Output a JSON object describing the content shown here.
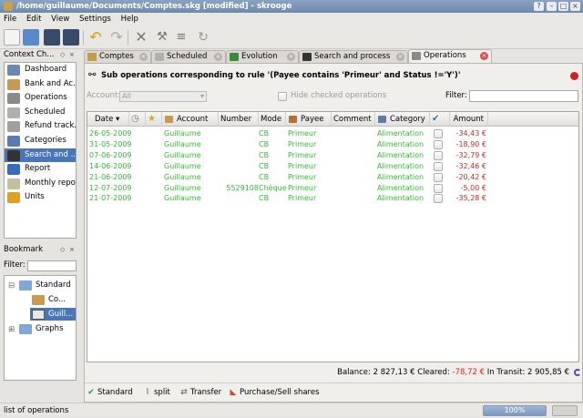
{
  "window": {
    "title": "/home/guillaume/Documents/Comptes.skg [modified] - skrooge"
  },
  "menu": [
    "File",
    "Edit",
    "View",
    "Settings",
    "Help"
  ],
  "context_dock": {
    "title": "Context Ch...",
    "items": [
      {
        "label": "Dashboard",
        "icon": "dashboard-icon",
        "color": "#6a8ab0"
      },
      {
        "label": "Bank and Ac...",
        "icon": "bank-icon",
        "color": "#c89a50"
      },
      {
        "label": "Operations",
        "icon": "operations-icon",
        "color": "#8a8a8a"
      },
      {
        "label": "Scheduled",
        "icon": "clock-icon",
        "color": "#b0b0b0"
      },
      {
        "label": "Refund track...",
        "icon": "refund-icon",
        "color": "#a0a0a0"
      },
      {
        "label": "Categories",
        "icon": "categories-icon",
        "color": "#5a7ab0"
      },
      {
        "label": "Search and ...",
        "icon": "binoculars-icon",
        "color": "#333333"
      },
      {
        "label": "Report",
        "icon": "report-icon",
        "color": "#3a6ac0"
      },
      {
        "label": "Monthly repor",
        "icon": "calendar-icon",
        "color": "#c0c0a0"
      },
      {
        "label": "Units",
        "icon": "units-icon",
        "color": "#e0a020"
      }
    ]
  },
  "bookmark_dock": {
    "title": "Bookmark",
    "filter_label": "Filter:",
    "tree": {
      "standard": "Standard",
      "co": "Co...",
      "guill": "Guill...",
      "graphs": "Graphs"
    }
  },
  "tabs": [
    {
      "label": "Comptes",
      "icon": "bank-icon",
      "color": "#c89a50"
    },
    {
      "label": "Scheduled",
      "icon": "clock-icon",
      "color": "#b0b0b0"
    },
    {
      "label": "Evolution",
      "icon": "chart-icon",
      "color": "#3a8a3a"
    },
    {
      "label": "Search and process",
      "icon": "binoculars-icon",
      "color": "#333333"
    },
    {
      "label": "Operations",
      "icon": "operations-icon",
      "color": "#8a8a8a"
    }
  ],
  "panel": {
    "header": "Sub operations corresponding to rule '(Payee contains 'Primeur' and Status !='Y')'",
    "account_label": "Account:",
    "account_value": "All",
    "hide_checked": "Hide checked operations",
    "filter_label": "Filter:"
  },
  "columns": [
    "Date",
    "",
    "",
    "Account",
    "Number",
    "Mode",
    "Payee",
    "Comment",
    "Category",
    "",
    "Amount"
  ],
  "rows": [
    {
      "date": "26-05-2009",
      "account": "Guillaume",
      "number": "",
      "mode": "CB",
      "payee": "Primeur",
      "category": "Alimentation",
      "amount": "-34,43 €"
    },
    {
      "date": "31-05-2009",
      "account": "Guillaume",
      "number": "",
      "mode": "CB",
      "payee": "Primeur",
      "category": "Alimentation",
      "amount": "-18,90 €"
    },
    {
      "date": "07-06-2009",
      "account": "Guillaume",
      "number": "",
      "mode": "CB",
      "payee": "Primeur",
      "category": "Alimentation",
      "amount": "-32,79 €"
    },
    {
      "date": "14-06-2009",
      "account": "Guillaume",
      "number": "",
      "mode": "CB",
      "payee": "Primeur",
      "category": "Alimentation",
      "amount": "-32,46 €"
    },
    {
      "date": "21-06-2009",
      "account": "Guillaume",
      "number": "",
      "mode": "CB",
      "payee": "Primeur",
      "category": "Alimentation",
      "amount": "-20,42 €"
    },
    {
      "date": "12-07-2009",
      "account": "Guillaume",
      "number": "5529108",
      "mode": "Chèque",
      "payee": "Primeur",
      "category": "Alimentation",
      "amount": "-5,00 €"
    },
    {
      "date": "21-07-2009",
      "account": "Guillaume",
      "number": "",
      "mode": "CB",
      "payee": "Primeur",
      "category": "Alimentation",
      "amount": "-35,28 €"
    }
  ],
  "balance": {
    "prefix": "Balance: 2 827,13 € Cleared: ",
    "cleared": "-78,72 €",
    "suffix": " In Transit: 2 905,85 €"
  },
  "buttons": [
    "Standard",
    "split",
    "Transfer",
    "Purchase/Sell shares"
  ],
  "statusbar": {
    "text": "list of operations",
    "progress": "100%"
  }
}
